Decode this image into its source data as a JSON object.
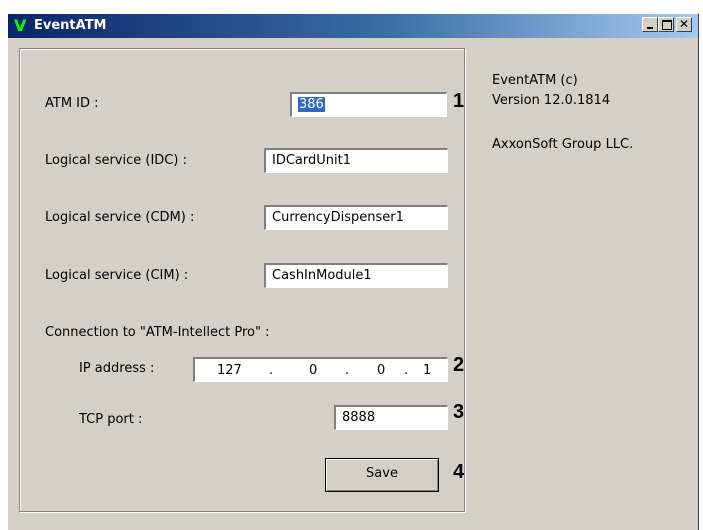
{
  "window": {
    "title": "EventATM",
    "app_icon": "V"
  },
  "form": {
    "atm_id": {
      "label": "ATM ID :",
      "value": "386"
    },
    "idc": {
      "label": "Logical service (IDC) :",
      "value": "IDCardUnit1"
    },
    "cdm": {
      "label": "Logical service (CDM) :",
      "value": "CurrencyDispenser1"
    },
    "cim": {
      "label": "Logical service (CIM) :",
      "value": "CashInModule1"
    },
    "connection_label": "Connection to \"ATM-Intellect Pro\" :",
    "ip": {
      "label": "IP address :",
      "octets": [
        "127",
        "0",
        "0",
        "1"
      ],
      "dot": "."
    },
    "port": {
      "label": "TCP port :",
      "value": "8888"
    },
    "save_label": "Save"
  },
  "markers": [
    "1",
    "2",
    "3",
    "4"
  ],
  "info": {
    "product": "EventATM (c)",
    "version": "Version 12.0.1814",
    "company": "AxxonSoft Group LLC."
  }
}
